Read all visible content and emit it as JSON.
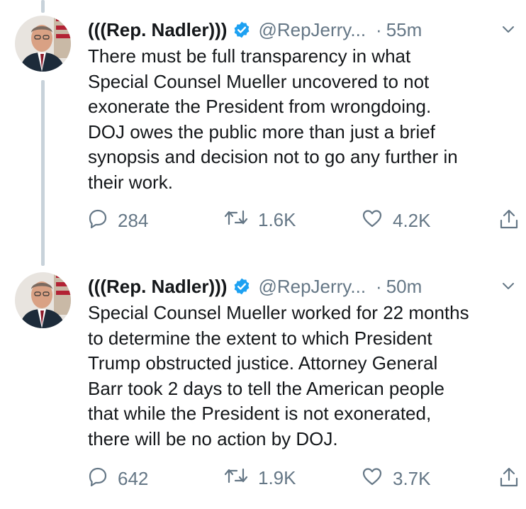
{
  "colors": {
    "text": "#14171a",
    "muted": "#657786",
    "verified": "#1da1f2",
    "thread_line": "#c8d2da"
  },
  "tweets": [
    {
      "author_name": "(((Rep. Nadler)))",
      "verified_icon": "verified-badge-icon",
      "handle": "@RepJerry...",
      "dot": "·",
      "time": "55m",
      "text": "There must be full transparency in what\nSpecial Counsel Mueller uncovered to not\nexonerate the President from wrongdoing.\nDOJ owes the public more than just a brief\nsynopsis and decision not to go any further in\ntheir work.",
      "replies": "284",
      "retweets": "1.6K",
      "likes": "4.2K"
    },
    {
      "author_name": "(((Rep. Nadler)))",
      "verified_icon": "verified-badge-icon",
      "handle": "@RepJerry...",
      "dot": "·",
      "time": "50m",
      "text": "Special Counsel Mueller worked for 22 months\nto determine the extent to which President\nTrump obstructed justice. Attorney General\nBarr took 2 days to tell the American people\nthat while the President is not exonerated,\nthere will be no action by DOJ.",
      "replies": "642",
      "retweets": "1.9K",
      "likes": "3.7K"
    }
  ]
}
